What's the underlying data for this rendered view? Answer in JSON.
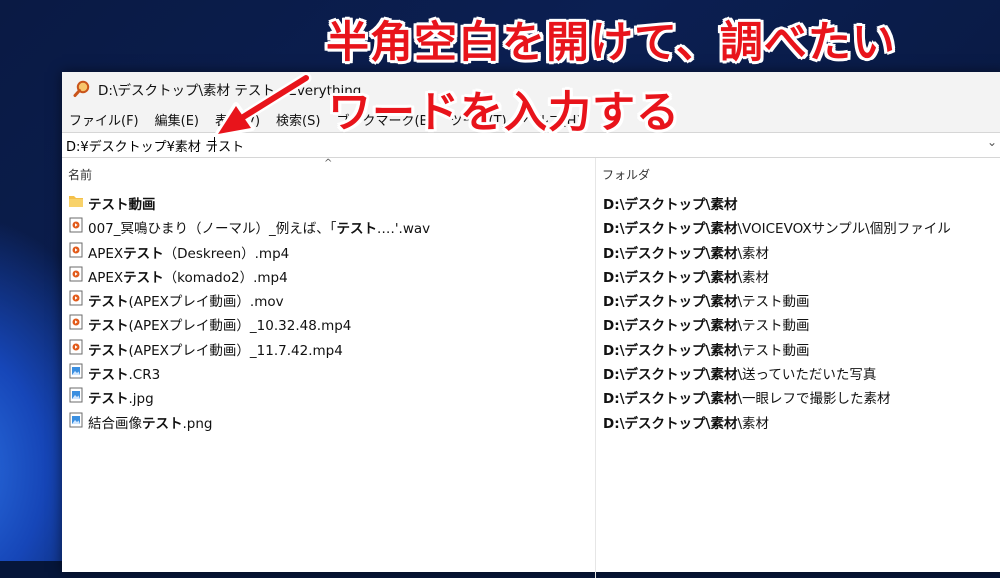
{
  "window": {
    "title": "D:\\デスクトップ\\素材 テスト - Everything"
  },
  "menu": [
    {
      "label": "ファイル(F)"
    },
    {
      "label": "編集(E)"
    },
    {
      "label": "表示(V)"
    },
    {
      "label": "検索(S)"
    },
    {
      "label": "ブックマーク(B)"
    },
    {
      "label": "ツール(T)"
    },
    {
      "label": "ヘルプ(H)"
    }
  ],
  "search": {
    "value": "D:¥デスクトップ¥素材 テスト"
  },
  "columns": {
    "name": "名前",
    "folder": "フォルダ"
  },
  "rows": [
    {
      "icon": "folder-icon",
      "name_bold": "テスト動画",
      "name_rest": "",
      "name_prefix": "",
      "folder_bold": "D:\\デスクトップ\\素材",
      "folder_rest": ""
    },
    {
      "icon": "audio-file-icon",
      "name_prefix": "007_冥鳴ひまり（ノーマル）_例えば、「",
      "name_bold": "テスト",
      "name_rest": ".…'.wav",
      "folder_bold": "D:\\デスクトップ\\素材",
      "folder_rest": "\\VOICEVOXサンプル\\個別ファイル"
    },
    {
      "icon": "video-file-icon",
      "name_prefix": "APEX",
      "name_bold": "テスト",
      "name_rest": "（Deskreen）.mp4",
      "folder_bold": "D:\\デスクトップ\\素材",
      "folder_rest": "\\素材"
    },
    {
      "icon": "video-file-icon",
      "name_prefix": "APEX",
      "name_bold": "テスト",
      "name_rest": "（komado2）.mp4",
      "folder_bold": "D:\\デスクトップ\\素材",
      "folder_rest": "\\素材"
    },
    {
      "icon": "video-file-icon",
      "name_prefix": "",
      "name_bold": "テスト",
      "name_rest": "(APEXプレイ動画）.mov",
      "folder_bold": "D:\\デスクトップ\\素材",
      "folder_rest": "\\テスト動画"
    },
    {
      "icon": "video-file-icon",
      "name_prefix": "",
      "name_bold": "テスト",
      "name_rest": "(APEXプレイ動画）_10.32.48.mp4",
      "folder_bold": "D:\\デスクトップ\\素材",
      "folder_rest": "\\テスト動画"
    },
    {
      "icon": "video-file-icon",
      "name_prefix": "",
      "name_bold": "テスト",
      "name_rest": "(APEXプレイ動画）_11.7.42.mp4",
      "folder_bold": "D:\\デスクトップ\\素材",
      "folder_rest": "\\テスト動画"
    },
    {
      "icon": "image-file-icon",
      "name_prefix": "",
      "name_bold": "テスト",
      "name_rest": ".CR3",
      "folder_bold": "D:\\デスクトップ\\素材",
      "folder_rest": "\\送っていただいた写真"
    },
    {
      "icon": "image-file-icon",
      "name_prefix": "",
      "name_bold": "テスト",
      "name_rest": ".jpg",
      "folder_bold": "D:\\デスクトップ\\素材",
      "folder_rest": "\\一眼レフで撮影した素材"
    },
    {
      "icon": "image-file-icon",
      "name_prefix": "結合画像",
      "name_bold": "テスト",
      "name_rest": ".png",
      "folder_bold": "D:\\デスクトップ\\素材",
      "folder_rest": "\\素材"
    }
  ],
  "annotation": {
    "line1": "半角空白を開けて、調べたい",
    "line2": "ワードを入力する"
  },
  "colors": {
    "annotation": "#e8141b",
    "folder": "#f4c04a"
  }
}
